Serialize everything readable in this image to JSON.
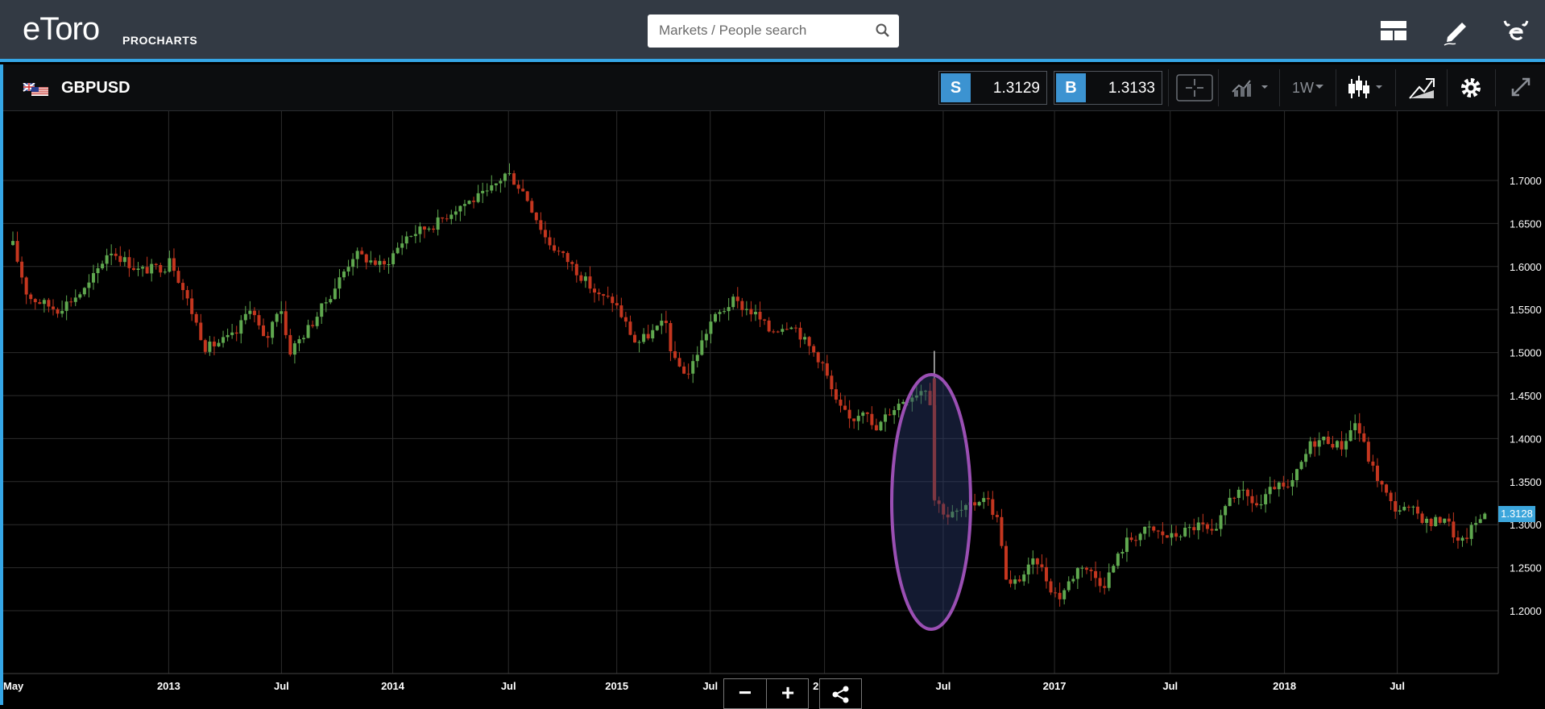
{
  "header": {
    "logo_text": "eToro",
    "logo_sub": "PROCHARTS",
    "search_placeholder": "Markets / People search",
    "icons": [
      "layout-icon",
      "pencil-icon",
      "etoro-user-icon"
    ]
  },
  "toolbar": {
    "symbol": "GBPUSD",
    "sell_label": "S",
    "sell_price": "1.3129",
    "buy_label": "B",
    "buy_price": "1.3133",
    "timeframe": "1W",
    "icons": [
      "crosshair-icon",
      "indicators-icon",
      "candlestick-type-icon",
      "drawing-tools-icon",
      "settings-icon",
      "fullscreen-icon"
    ]
  },
  "controls": {
    "zoom_out": "−",
    "zoom_in": "+",
    "share_icon": "share-icon"
  },
  "colors": {
    "up": "#5fa84f",
    "down": "#c4361f",
    "accent": "#35a6e6",
    "highlight": "#9a4fb3"
  },
  "chart_data": {
    "type": "candlestick",
    "symbol": "GBPUSD",
    "timeframe": "1W",
    "ylim": [
      1.19,
      1.72
    ],
    "yticks": [
      "1.7000",
      "1.6500",
      "1.6000",
      "1.5500",
      "1.5000",
      "1.4500",
      "1.4000",
      "1.3500",
      "1.3000",
      "1.2500",
      "1.2000"
    ],
    "xticks": [
      {
        "label": "May",
        "t": 0
      },
      {
        "label": "2013",
        "t": 0.105
      },
      {
        "label": "Jul",
        "t": 0.181
      },
      {
        "label": "2014",
        "t": 0.256
      },
      {
        "label": "Jul",
        "t": 0.334
      },
      {
        "label": "2015",
        "t": 0.407
      },
      {
        "label": "Jul",
        "t": 0.47
      },
      {
        "label": "2016",
        "t": 0.547
      },
      {
        "label": "Jul",
        "t": 0.627
      },
      {
        "label": "2017",
        "t": 0.702
      },
      {
        "label": "Jul",
        "t": 0.78
      },
      {
        "label": "2018",
        "t": 0.857
      },
      {
        "label": "Jul",
        "t": 0.933
      }
    ],
    "last_price": "1.3128",
    "last_price_value": 1.3128,
    "trend": [
      [
        0,
        1.625
      ],
      [
        0.01,
        1.565
      ],
      [
        0.03,
        1.55
      ],
      [
        0.05,
        1.575
      ],
      [
        0.065,
        1.62
      ],
      [
        0.085,
        1.595
      ],
      [
        0.103,
        1.6
      ],
      [
        0.105,
        1.615
      ],
      [
        0.12,
        1.55
      ],
      [
        0.13,
        1.505
      ],
      [
        0.15,
        1.52
      ],
      [
        0.16,
        1.555
      ],
      [
        0.17,
        1.51
      ],
      [
        0.18,
        1.56
      ],
      [
        0.186,
        1.5
      ],
      [
        0.2,
        1.53
      ],
      [
        0.215,
        1.57
      ],
      [
        0.23,
        1.615
      ],
      [
        0.25,
        1.6
      ],
      [
        0.265,
        1.635
      ],
      [
        0.285,
        1.65
      ],
      [
        0.3,
        1.67
      ],
      [
        0.32,
        1.685
      ],
      [
        0.333,
        1.71
      ],
      [
        0.345,
        1.685
      ],
      [
        0.36,
        1.63
      ],
      [
        0.375,
        1.605
      ],
      [
        0.395,
        1.565
      ],
      [
        0.405,
        1.56
      ],
      [
        0.42,
        1.51
      ],
      [
        0.44,
        1.535
      ],
      [
        0.445,
        1.49
      ],
      [
        0.455,
        1.475
      ],
      [
        0.47,
        1.535
      ],
      [
        0.485,
        1.56
      ],
      [
        0.5,
        1.545
      ],
      [
        0.51,
        1.525
      ],
      [
        0.525,
        1.535
      ],
      [
        0.535,
        1.51
      ],
      [
        0.545,
        1.49
      ],
      [
        0.555,
        1.44
      ],
      [
        0.565,
        1.42
      ],
      [
        0.575,
        1.44
      ],
      [
        0.58,
        1.405
      ],
      [
        0.59,
        1.43
      ],
      [
        0.6,
        1.445
      ],
      [
        0.615,
        1.46
      ],
      [
        0.62,
        1.435
      ],
      [
        0.621,
        1.33
      ],
      [
        0.63,
        1.31
      ],
      [
        0.645,
        1.32
      ],
      [
        0.655,
        1.335
      ],
      [
        0.665,
        1.3
      ],
      [
        0.67,
        1.225
      ],
      [
        0.68,
        1.24
      ],
      [
        0.69,
        1.26
      ],
      [
        0.7,
        1.225
      ],
      [
        0.705,
        1.215
      ],
      [
        0.72,
        1.255
      ],
      [
        0.735,
        1.23
      ],
      [
        0.75,
        1.28
      ],
      [
        0.765,
        1.295
      ],
      [
        0.78,
        1.285
      ],
      [
        0.8,
        1.3
      ],
      [
        0.81,
        1.285
      ],
      [
        0.82,
        1.335
      ],
      [
        0.83,
        1.335
      ],
      [
        0.84,
        1.32
      ],
      [
        0.85,
        1.345
      ],
      [
        0.86,
        1.34
      ],
      [
        0.875,
        1.395
      ],
      [
        0.885,
        1.4
      ],
      [
        0.895,
        1.39
      ],
      [
        0.905,
        1.42
      ],
      [
        0.915,
        1.37
      ],
      [
        0.93,
        1.32
      ],
      [
        0.945,
        1.315
      ],
      [
        0.955,
        1.3
      ],
      [
        0.965,
        1.31
      ],
      [
        0.975,
        1.275
      ],
      [
        0.985,
        1.3
      ],
      [
        0.992,
        1.3128
      ]
    ]
  }
}
